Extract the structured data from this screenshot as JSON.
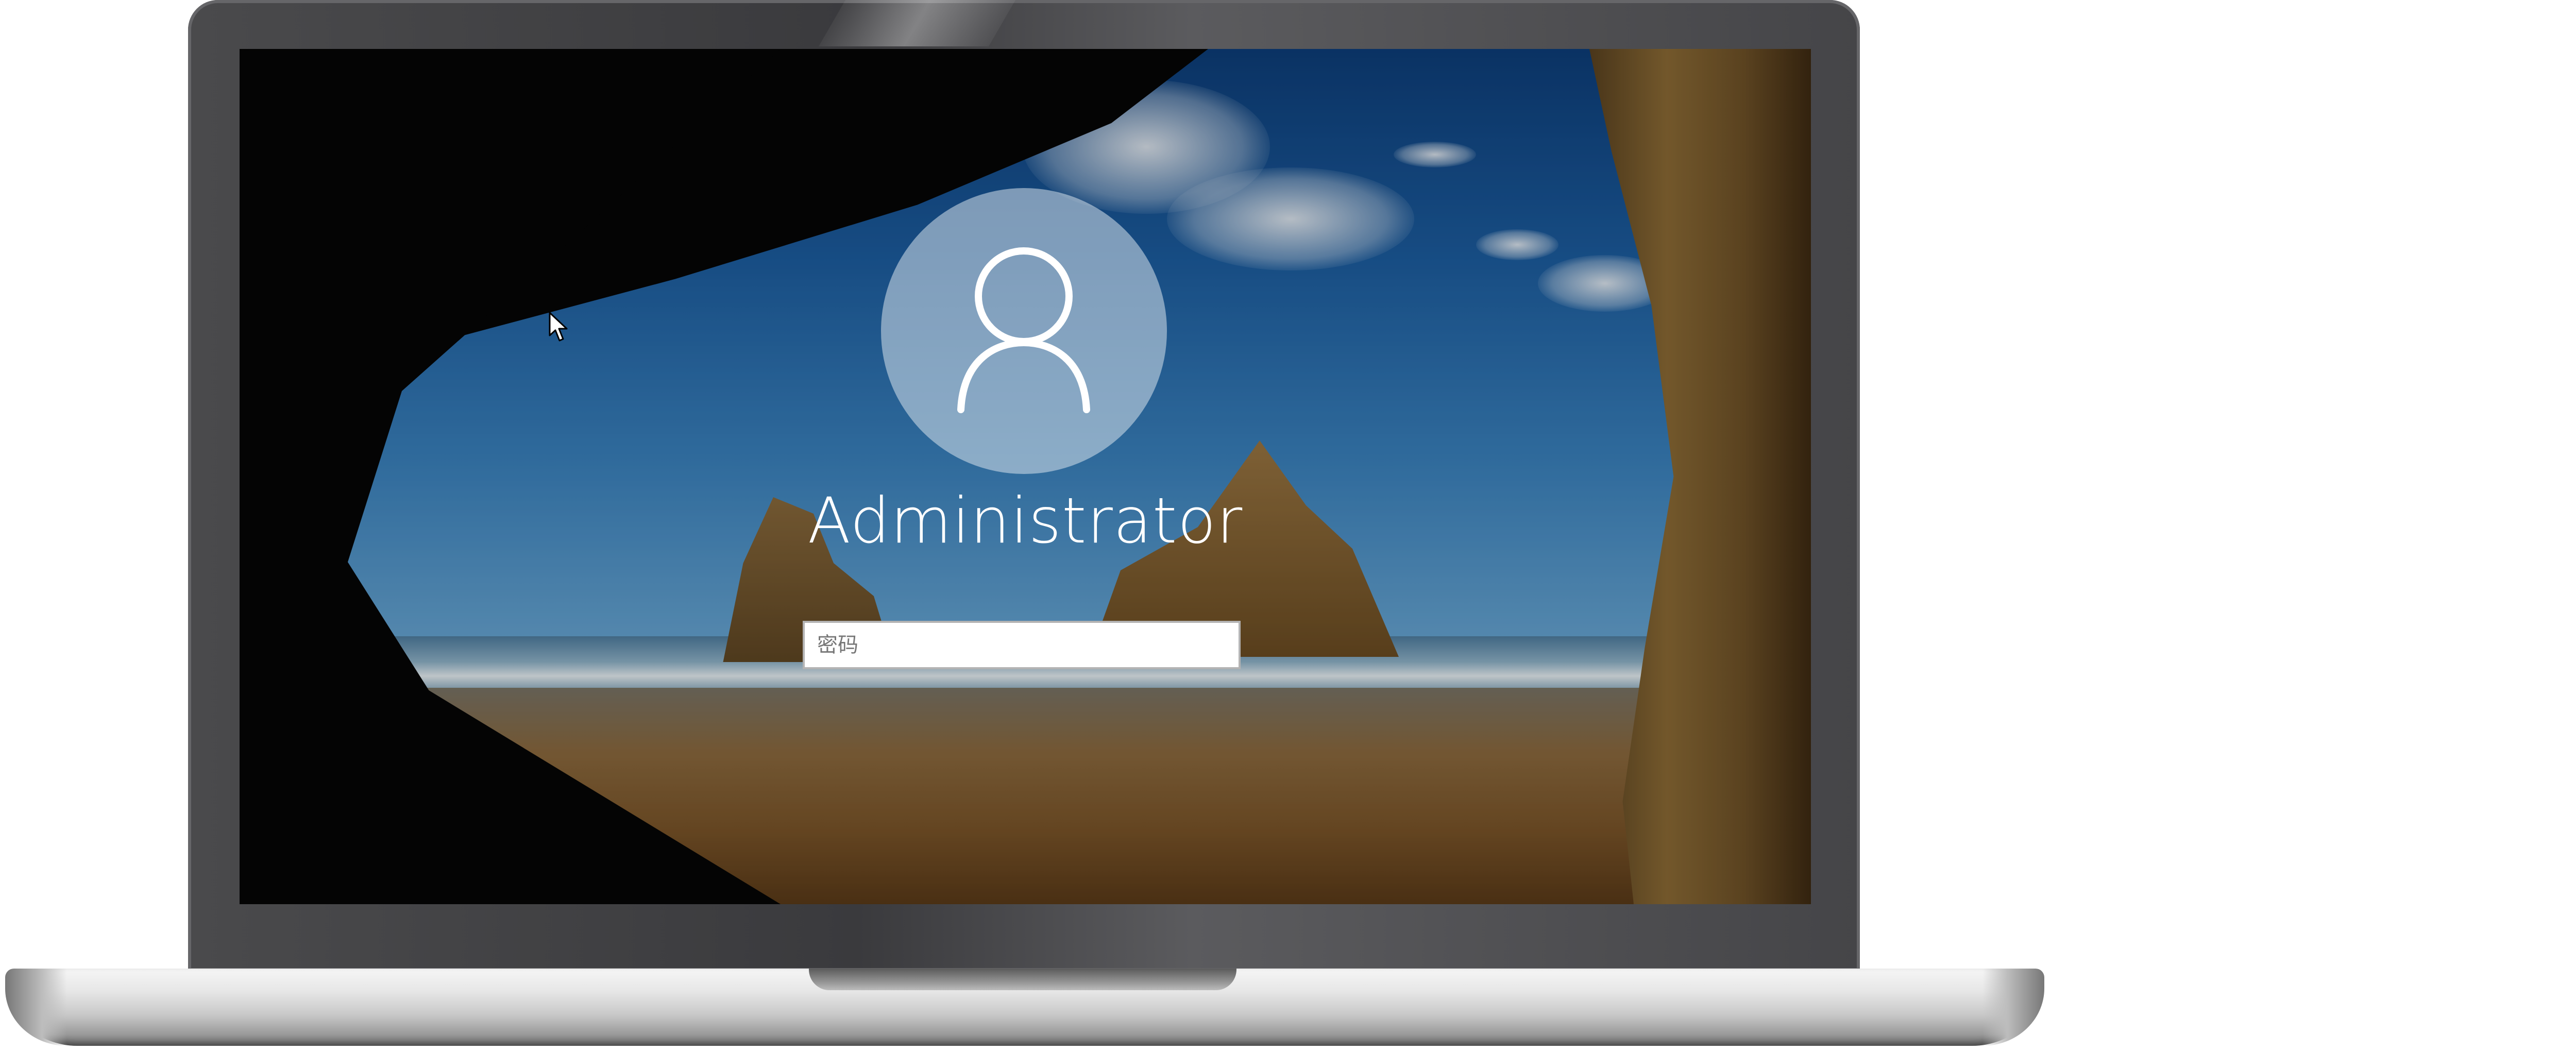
{
  "login": {
    "username": "Administrator",
    "password_placeholder": "密码",
    "password_value": ""
  },
  "icons": {
    "avatar": "user-icon",
    "cursor": "mouse-pointer-icon"
  },
  "colors": {
    "avatar_background": "#d7e1eb",
    "username_text": "#ffffff",
    "input_background": "#ffffff"
  }
}
